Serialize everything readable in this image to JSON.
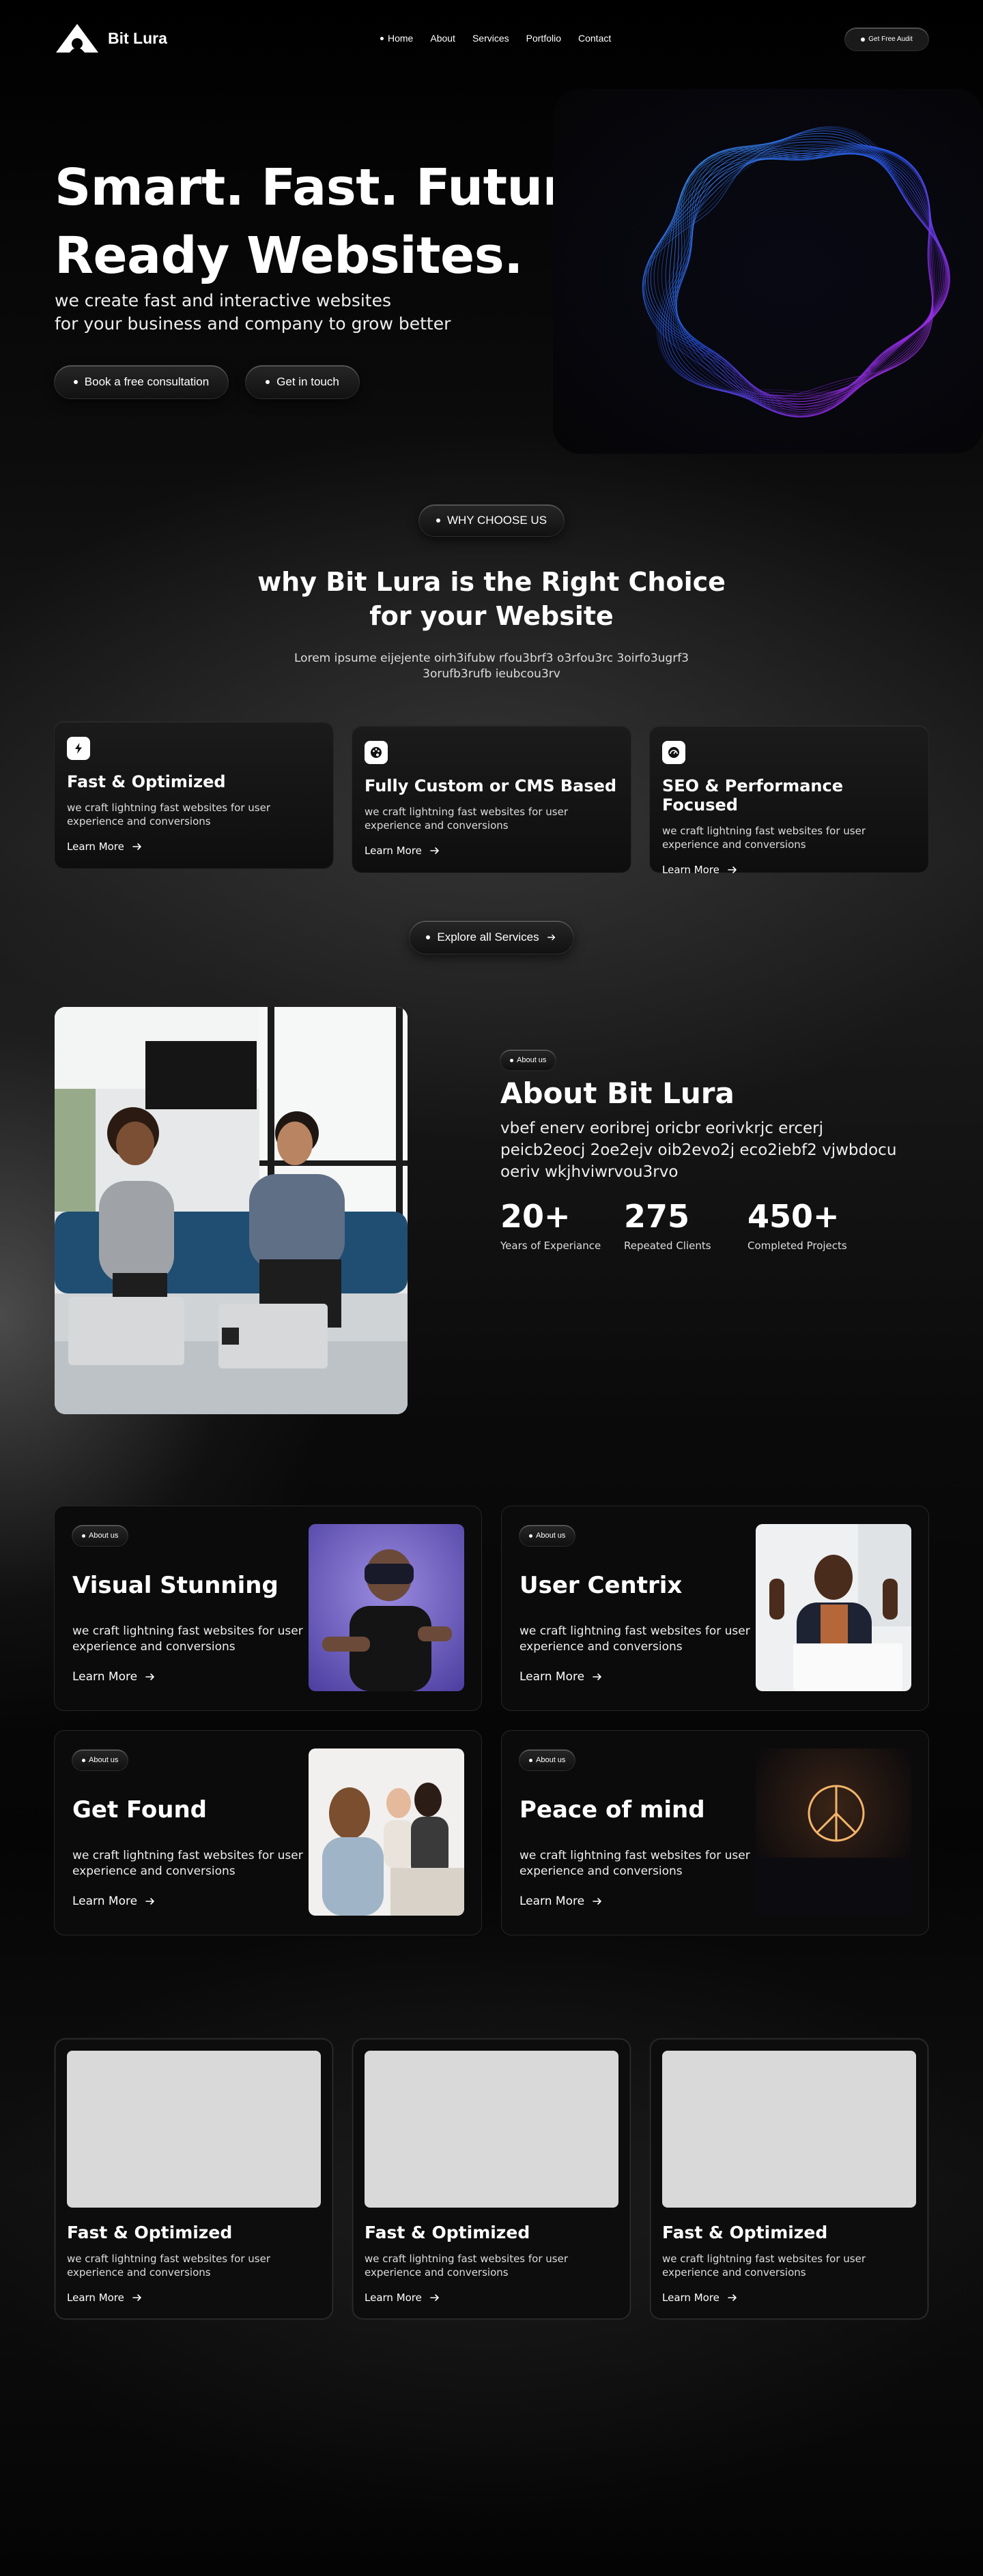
{
  "brand": {
    "name": "Bit Lura"
  },
  "nav": {
    "items": [
      {
        "label": "Home",
        "active": true
      },
      {
        "label": "About"
      },
      {
        "label": "Services"
      },
      {
        "label": "Portfolio"
      },
      {
        "label": "Contact"
      }
    ],
    "cta": "Get Free Audit"
  },
  "hero": {
    "title_line1": "Smart. Fast. Future",
    "title_line2": "Ready Websites.",
    "sub_line1": "we create fast and interactive websites",
    "sub_line2": "for your business and company to grow better",
    "btn_primary": "Book a free consultation",
    "btn_secondary": "Get in touch"
  },
  "why": {
    "badge": "WHY CHOOSE US",
    "title_line1": "why Bit Lura is the Right Choice",
    "title_line2": "for your Website",
    "desc": "Lorem ipsume eijejente oirh3ifubw rfou3brf3 o3rfou3rc 3oirfo3ugrf3 3orufb3rufb ieubcou3rv",
    "cards": [
      {
        "icon": "lightning-icon",
        "title": "Fast & Optimized",
        "desc": "we craft lightning fast websites for user experience and conversions",
        "link": "Learn More"
      },
      {
        "icon": "palette-icon",
        "title": "Fully Custom or CMS Based",
        "desc": "we craft lightning fast websites for user experience and conversions",
        "link": "Learn More"
      },
      {
        "icon": "speedometer-icon",
        "title": "SEO & Performance Focused",
        "desc": "we craft lightning fast websites for user experience and conversions",
        "link": "Learn More"
      }
    ],
    "explore": "Explore all Services"
  },
  "about": {
    "badge": "About us",
    "title": "About Bit Lura",
    "text": "vbef enerv eoribrej oricbr eorivkrjc ercerj peicb2eocj 2oe2ejv oib2evo2j eco2iebf2 vjwbdocu oeriv wkjhviwrvou3rvo",
    "stats": [
      {
        "num": "20+",
        "label": "Years of Experiance"
      },
      {
        "num": "275",
        "label": "Repeated Clients"
      },
      {
        "num": "450+",
        "label": "Completed Projects"
      }
    ]
  },
  "tiles": [
    {
      "badge": "About us",
      "title": "Visual Stunning",
      "desc": "we craft lightning fast websites for user experience and conversions",
      "link": "Learn More"
    },
    {
      "badge": "About us",
      "title": "User Centrix",
      "desc": "we craft lightning fast websites for user experience and conversions",
      "link": "Learn More"
    },
    {
      "badge": "About us",
      "title": "Get Found",
      "desc": "we craft lightning fast websites for user experience and conversions",
      "link": "Learn More"
    },
    {
      "badge": "About us",
      "title": "Peace of mind",
      "desc": "we craft lightning fast websites for user experience and conversions",
      "link": "Learn More"
    }
  ],
  "portfolio": [
    {
      "title": "Fast & Optimized",
      "desc": "we craft lightning fast websites for user experience and conversions",
      "link": "Learn More"
    },
    {
      "title": "Fast & Optimized",
      "desc": "we craft lightning fast websites for user experience and conversions",
      "link": "Learn More"
    },
    {
      "title": "Fast & Optimized",
      "desc": "we craft lightning fast websites for user experience and conversions",
      "link": "Learn More"
    }
  ],
  "colors": {
    "background": "#000000",
    "card": "#141414",
    "placeholder": "#d9d9d9",
    "ring_blue": "#2f7bff",
    "ring_purple": "#8a2be2"
  }
}
